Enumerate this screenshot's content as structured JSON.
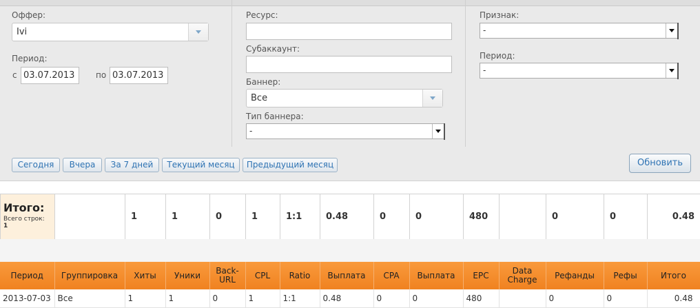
{
  "filters": {
    "offer_label": "Оффер:",
    "offer_value": "Ivi",
    "period_label": "Период:",
    "from_label": "с",
    "from_value": "03.07.2013",
    "to_label": "по",
    "to_value": "03.07.2013",
    "resource_label": "Ресурс:",
    "resource_value": "",
    "subaccount_label": "Субаккаунт:",
    "subaccount_value": "",
    "banner_label": "Баннер:",
    "banner_value": "Все",
    "banner_type_label": "Тип баннера:",
    "banner_type_value": "-",
    "sign_label": "Признак:",
    "sign_value": "-",
    "period2_label": "Период:",
    "period2_value": "-"
  },
  "quick_buttons": [
    "Сегодня",
    "Вчера",
    "За 7 дней",
    "Текущий месяц",
    "Предыдущий месяц"
  ],
  "refresh_label": "Обновить",
  "totals": {
    "title": "Итого:",
    "rows_label": "Всего строк:",
    "rows_count": "1",
    "values": [
      "",
      "1",
      "1",
      "0",
      "1",
      "1:1",
      "0.48",
      "0",
      "0",
      "480",
      "",
      "0",
      "0",
      "0.48"
    ]
  },
  "table": {
    "headers": [
      "Период",
      "Группировка",
      "Хиты",
      "Уники",
      "Back-URL",
      "CPL",
      "Ratio",
      "Выплата",
      "CPA",
      "Выплата",
      "EPC",
      "Data Charge",
      "Рефанды",
      "Рефы",
      "Итого"
    ],
    "rows": [
      [
        "2013-07-03",
        "Все",
        "1",
        "1",
        "0",
        "1",
        "1:1",
        "0.48",
        "0",
        "0",
        "480",
        "",
        "0",
        "0",
        "0.48"
      ]
    ]
  },
  "colors": {
    "header_orange": "#f08220",
    "link_blue": "#2e73b3",
    "totals_bg": "#fdf0dc"
  }
}
